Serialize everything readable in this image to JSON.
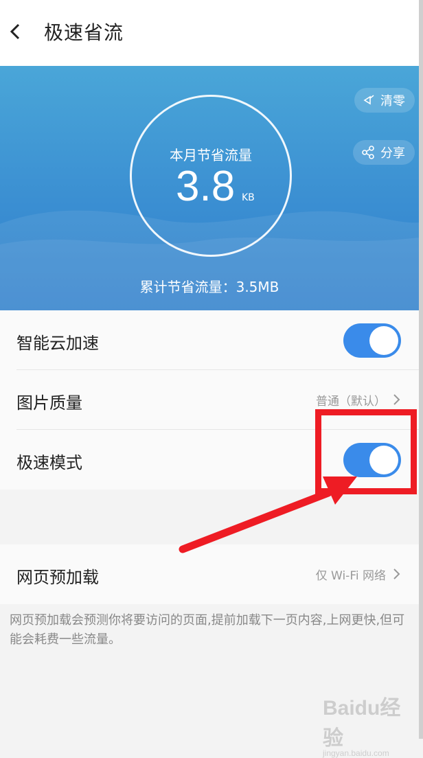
{
  "header": {
    "title": "极速省流"
  },
  "hero": {
    "month_label": "本月节省流量",
    "month_value": "3.8",
    "month_unit": "KB",
    "total_label": "累计节省流量：3.5MB",
    "clear_button": "清零",
    "share_button": "分享"
  },
  "settings": {
    "cloud_accel": {
      "label": "智能云加速",
      "on": true
    },
    "image_quality": {
      "label": "图片质量",
      "value": "普通（默认）"
    },
    "speed_mode": {
      "label": "极速模式",
      "on": true
    },
    "preload": {
      "label": "网页预加载",
      "value": "仅 Wi-Fi 网络"
    }
  },
  "description": "网页预加载会预测你将要访问的页面,提前加载下一页内容,上网更快,但可能会耗费一些流量。",
  "watermark": {
    "main": "Baidu经验",
    "url": "jingyan.baidu.com"
  },
  "colors": {
    "accent": "#3a8bea",
    "annotation": "#ee1c24",
    "hero_top": "#4aa6d8",
    "hero_bottom": "#2f7fcb"
  }
}
